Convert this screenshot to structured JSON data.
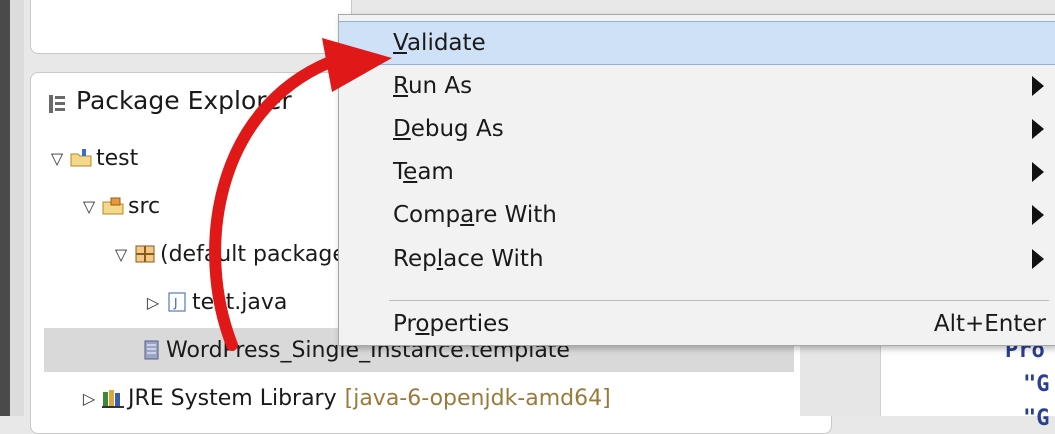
{
  "explorer": {
    "title": "Package Explorer",
    "tree": [
      {
        "label": "test"
      },
      {
        "label": "src"
      },
      {
        "label": "(default package)"
      },
      {
        "label": "test.java"
      },
      {
        "label": "WordPress_Single_Instance.template"
      },
      {
        "label": "JRE System Library",
        "decoration": "[java-6-openjdk-amd64]"
      }
    ]
  },
  "context_menu": {
    "items": [
      {
        "pre": "",
        "mn": "V",
        "post": "alidate"
      },
      {
        "pre": "",
        "mn": "R",
        "post": "un As"
      },
      {
        "pre": "",
        "mn": "D",
        "post": "ebug As"
      },
      {
        "pre": "T",
        "mn": "e",
        "post": "am"
      },
      {
        "pre": "Comp",
        "mn": "a",
        "post": "re With"
      },
      {
        "pre": "Rep",
        "mn": "l",
        "post": "ace With"
      },
      {
        "pre": "Pr",
        "mn": "o",
        "post": "perties",
        "accelerator": "Alt+Enter"
      }
    ]
  },
  "editor": {
    "lines": [
      "Pro",
      "\"G",
      "\"G"
    ]
  },
  "colors": {
    "highlight": "#cfe1f7",
    "annotation_arrow": "#e01818",
    "decoration": "#9a7a3a",
    "code_keyword": "#2a3f8f"
  }
}
